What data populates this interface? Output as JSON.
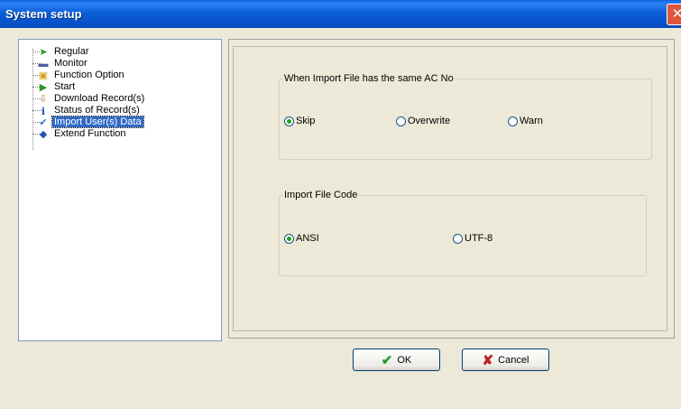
{
  "window": {
    "title": "System setup",
    "close_glyph": "✕"
  },
  "tree": {
    "items": [
      {
        "label": "Regular",
        "icon": "regular-arrow-icon",
        "glyph": "➤",
        "color": "#2a9b2a"
      },
      {
        "label": "Monitor",
        "icon": "monitor-icon",
        "glyph": "▬",
        "color": "#4a5fa0"
      },
      {
        "label": "Function Option",
        "icon": "function-option-icon",
        "glyph": "▣",
        "color": "#d4a020"
      },
      {
        "label": "Start",
        "icon": "play-icon",
        "glyph": "▶",
        "color": "#2a9b2a"
      },
      {
        "label": "Download Record(s)",
        "icon": "download-icon",
        "glyph": "⇩",
        "color": "#d07020"
      },
      {
        "label": "Status of Record(s)",
        "icon": "info-icon",
        "glyph": "i",
        "color": "#2050c0"
      },
      {
        "label": "Import User(s) Data",
        "icon": "checkmark-icon",
        "glyph": "✔",
        "color": "#3070d0"
      },
      {
        "label": "Extend Function",
        "icon": "extend-function-icon",
        "glyph": "◆",
        "color": "#2050b0"
      }
    ],
    "selected_index": 6
  },
  "group_same_ac": {
    "legend": "When Import File has the same AC No",
    "options": [
      {
        "label": "Skip",
        "selected": true
      },
      {
        "label": "Overwrite",
        "selected": false
      },
      {
        "label": "Warn",
        "selected": false
      }
    ]
  },
  "group_code": {
    "legend": "Import File Code",
    "options": [
      {
        "label": "ANSI",
        "selected": true
      },
      {
        "label": "UTF-8",
        "selected": false
      }
    ]
  },
  "buttons": {
    "ok": {
      "label": "OK",
      "glyph": "✔",
      "color": "#2a9b2a"
    },
    "cancel": {
      "label": "Cancel",
      "glyph": "✘",
      "color": "#c02020"
    }
  }
}
